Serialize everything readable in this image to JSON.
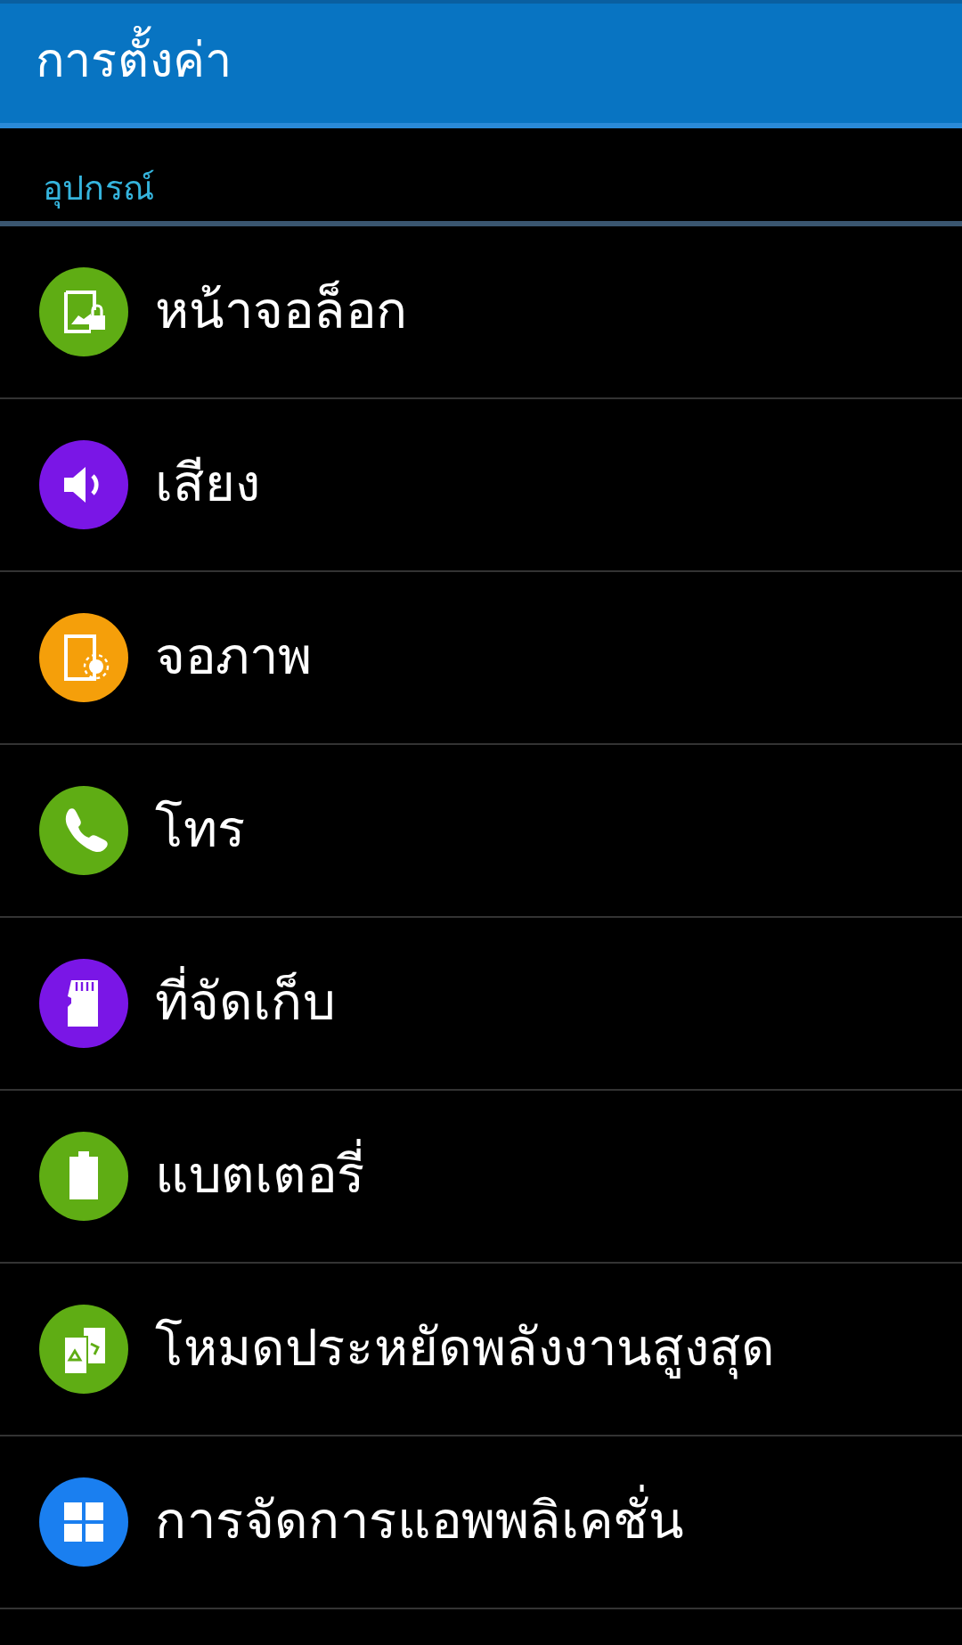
{
  "header": {
    "title": "การตั้งค่า"
  },
  "section": {
    "title": "อุปกรณ์"
  },
  "items": [
    {
      "label": "หน้าจอล็อก",
      "kind": "lockscreen",
      "color": "#5fad14"
    },
    {
      "label": "เสียง",
      "kind": "sound",
      "color": "#7a16e6"
    },
    {
      "label": "จอภาพ",
      "kind": "display",
      "color": "#f59f0a"
    },
    {
      "label": "โทร",
      "kind": "call",
      "color": "#5fad14"
    },
    {
      "label": "ที่จัดเก็บ",
      "kind": "storage",
      "color": "#7a16e6"
    },
    {
      "label": "แบตเตอรี่",
      "kind": "battery",
      "color": "#5fad14"
    },
    {
      "label": "โหมดประหยัดพลังงานสูงสุด",
      "kind": "powersaving",
      "color": "#5fad14"
    },
    {
      "label": "การจัดการแอพพลิเคชั่น",
      "kind": "apps",
      "color": "#1a7ff0"
    }
  ]
}
